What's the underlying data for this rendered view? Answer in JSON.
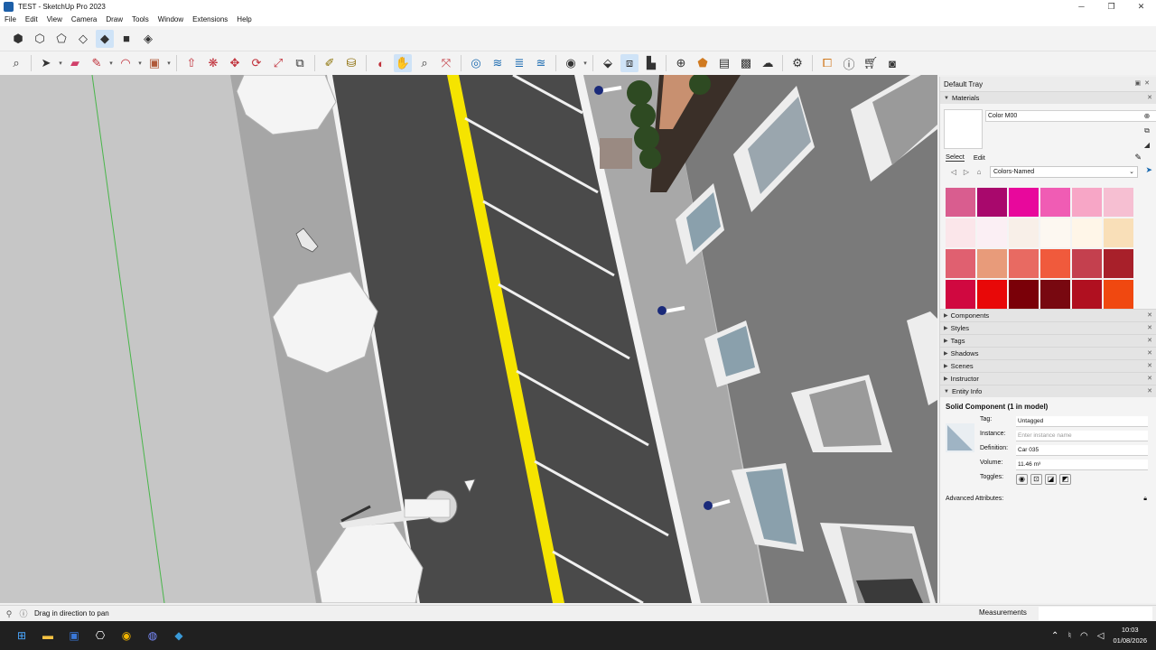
{
  "window": {
    "title": "TEST - SketchUp Pro 2023",
    "controls": [
      "─",
      "❐",
      "✕"
    ]
  },
  "menu": [
    "File",
    "Edit",
    "View",
    "Camera",
    "Draw",
    "Tools",
    "Window",
    "Extensions",
    "Help"
  ],
  "tray": {
    "title": "Default Tray",
    "materials": {
      "heading": "Materials",
      "current_name": "Color M00",
      "tabs": [
        "Select",
        "Edit"
      ],
      "library": "Colors-Named",
      "swatches": [
        "#d95d8f",
        "#a8086c",
        "#e8089c",
        "#f05cb4",
        "#f7a6c6",
        "#f6bfd2",
        "#fbe6ea",
        "#fbeff4",
        "#f8efe8",
        "#fdf8f1",
        "#fff6e8",
        "#f9dfb8",
        "#e06070",
        "#e89b7a",
        "#e86a62",
        "#f05a3c",
        "#c4404e",
        "#a8202a",
        "#d00840",
        "#e80808",
        "#7a0008",
        "#780810",
        "#b01020",
        "#f04810"
      ]
    },
    "panels": [
      "Components",
      "Styles",
      "Tags",
      "Shadows",
      "Scenes",
      "Instructor",
      "Entity Info"
    ],
    "entity_info": {
      "title": "Solid Component (1 in model)",
      "tag_label": "Tag:",
      "tag_value": "Untagged",
      "instance_label": "Instance:",
      "instance_placeholder": "Enter instance name",
      "definition_label": "Definition:",
      "definition_value": "Car 035",
      "volume_label": "Volume:",
      "volume_value": "11.46 m³",
      "toggles_label": "Toggles:",
      "advanced_label": "Advanced Attributes:"
    }
  },
  "status": {
    "text": "Drag in direction to pan",
    "measurements_label": "Measurements"
  },
  "taskbar": {
    "time": "10:03",
    "date": "01/08/2026"
  },
  "colors": {
    "road": "#4a4a4a",
    "sidewalk": "#a6a6a6",
    "yellow_line": "#f5e400",
    "axis_green": "#49b64a"
  }
}
